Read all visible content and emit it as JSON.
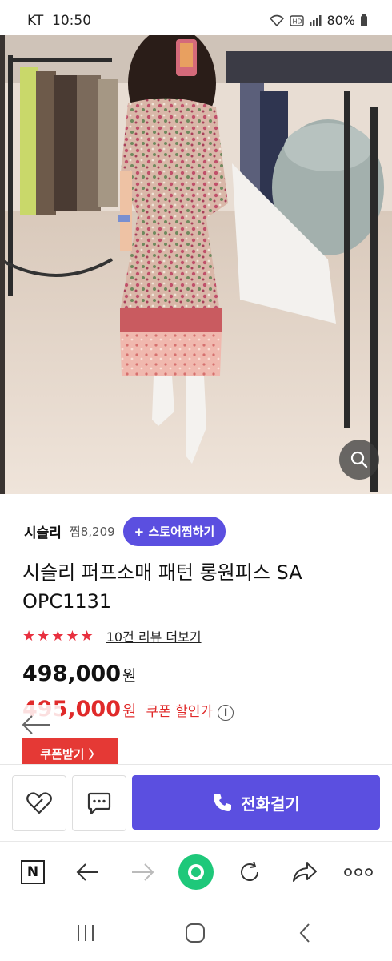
{
  "status_bar": {
    "carrier": "KT",
    "time": "10:50",
    "battery": "80%"
  },
  "carousel": {
    "total": 5,
    "active_index": 0
  },
  "store": {
    "name": "시슬리",
    "likes": "찜8,209",
    "follow_label": "+ 스토어찜하기"
  },
  "product": {
    "title": "시슬리 퍼프소매 패턴 롱원피스 SA OPC1131",
    "rating": 5,
    "review_link": "10건 리뷰 더보기",
    "price": "498,000",
    "price_unit": "원",
    "coupon_price": "495,000",
    "coupon_price_unit": "원",
    "coupon_label": "쿠폰 할인가",
    "coupon_button": "쿠폰받기 〉"
  },
  "action_bar": {
    "call_label": "전화걸기"
  },
  "browser_bar": {
    "n_label": "N"
  },
  "colors": {
    "accent": "#5b4fe0",
    "red": "#e02a2a",
    "coupon_bg": "#e53935",
    "home_green": "#1ec87a"
  }
}
